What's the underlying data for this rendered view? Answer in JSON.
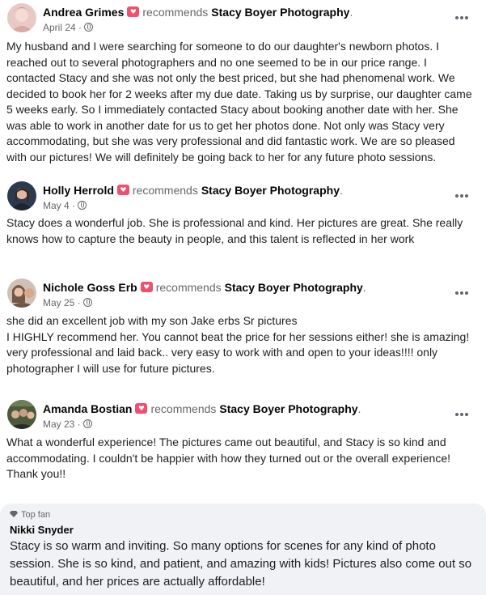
{
  "reco_word": "recommends",
  "reviews": [
    {
      "author": "Andrea Grimes",
      "page": "Stacy Boyer Photography",
      "date": "April 24 ·",
      "text": "My husband and I were searching for someone to do our daughter's newborn photos. I reached out to several photographers and no one seemed to be in our price range. I contacted Stacy and she was not only the best priced, but she had phenomenal work. We decided to book her for 2 weeks after my due date. Taking us by surprise, our daughter came 5 weeks early. So I immediately contacted Stacy about booking another date with her. She was able to work in another date for us to get her photos done. Not only was Stacy very accommodating, but she was very professional and did fantastic work. We are so pleased with our pictures! We will definitely be going back to her for any future photo sessions."
    },
    {
      "author": "Holly Herrold",
      "page": "Stacy Boyer Photography",
      "date": "May 4 ·",
      "text": "Stacy does a wonderful job. She is professional and kind. Her pictures are great. She really knows how to capture the beauty in people, and this talent is reflected in her work"
    },
    {
      "author": "Nichole Goss Erb",
      "page": "Stacy Boyer Photography",
      "date": "May 25 ·",
      "text": "she did an excellent job with my son Jake erbs Sr pictures\nI HIGHLY recommend her. You cannot beat the price for her sessions either! she is amazing!  very professional and laid back.. very easy to work with and open to your ideas!!!! only photographer I will use for future pictures."
    },
    {
      "author": "Amanda Bostian",
      "page": "Stacy Boyer Photography",
      "date": "May 23 ·",
      "text": "What a wonderful experience! The pictures came out beautiful, and Stacy is so kind and accommodating. I couldn't be happier with how they turned out or the overall experience! Thank you!!"
    }
  ],
  "top_fan": {
    "badge": "Top fan",
    "name": "Nikki Snyder",
    "text": "Stacy is so warm and inviting. So many options for scenes for any kind of photo session. She is so kind, and patient, and amazing with kids! Pictures also come out so beautiful, and her prices are actually affordable!"
  },
  "icons": {
    "recommend": "recommend-badge-icon",
    "privacy": "globe-icon",
    "more": "more-options-icon",
    "top_fan": "diamond-icon"
  }
}
